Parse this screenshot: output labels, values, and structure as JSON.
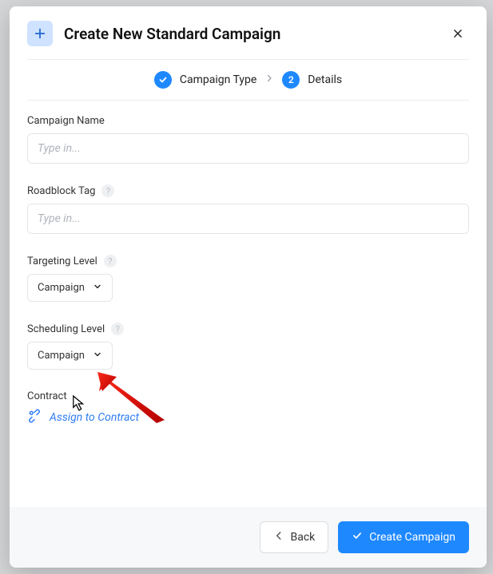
{
  "modal": {
    "title": "Create New Standard Campaign"
  },
  "stepper": {
    "step1_label": "Campaign Type",
    "step2_number": "2",
    "step2_label": "Details"
  },
  "fields": {
    "campaign_name": {
      "label": "Campaign Name",
      "placeholder": "Type in..."
    },
    "roadblock_tag": {
      "label": "Roadblock Tag",
      "placeholder": "Type in..."
    },
    "targeting_level": {
      "label": "Targeting Level",
      "value": "Campaign"
    },
    "scheduling_level": {
      "label": "Scheduling Level",
      "value": "Campaign"
    },
    "contract": {
      "label": "Contract",
      "link": "Assign to Contract"
    }
  },
  "footer": {
    "back": "Back",
    "submit": "Create Campaign"
  }
}
